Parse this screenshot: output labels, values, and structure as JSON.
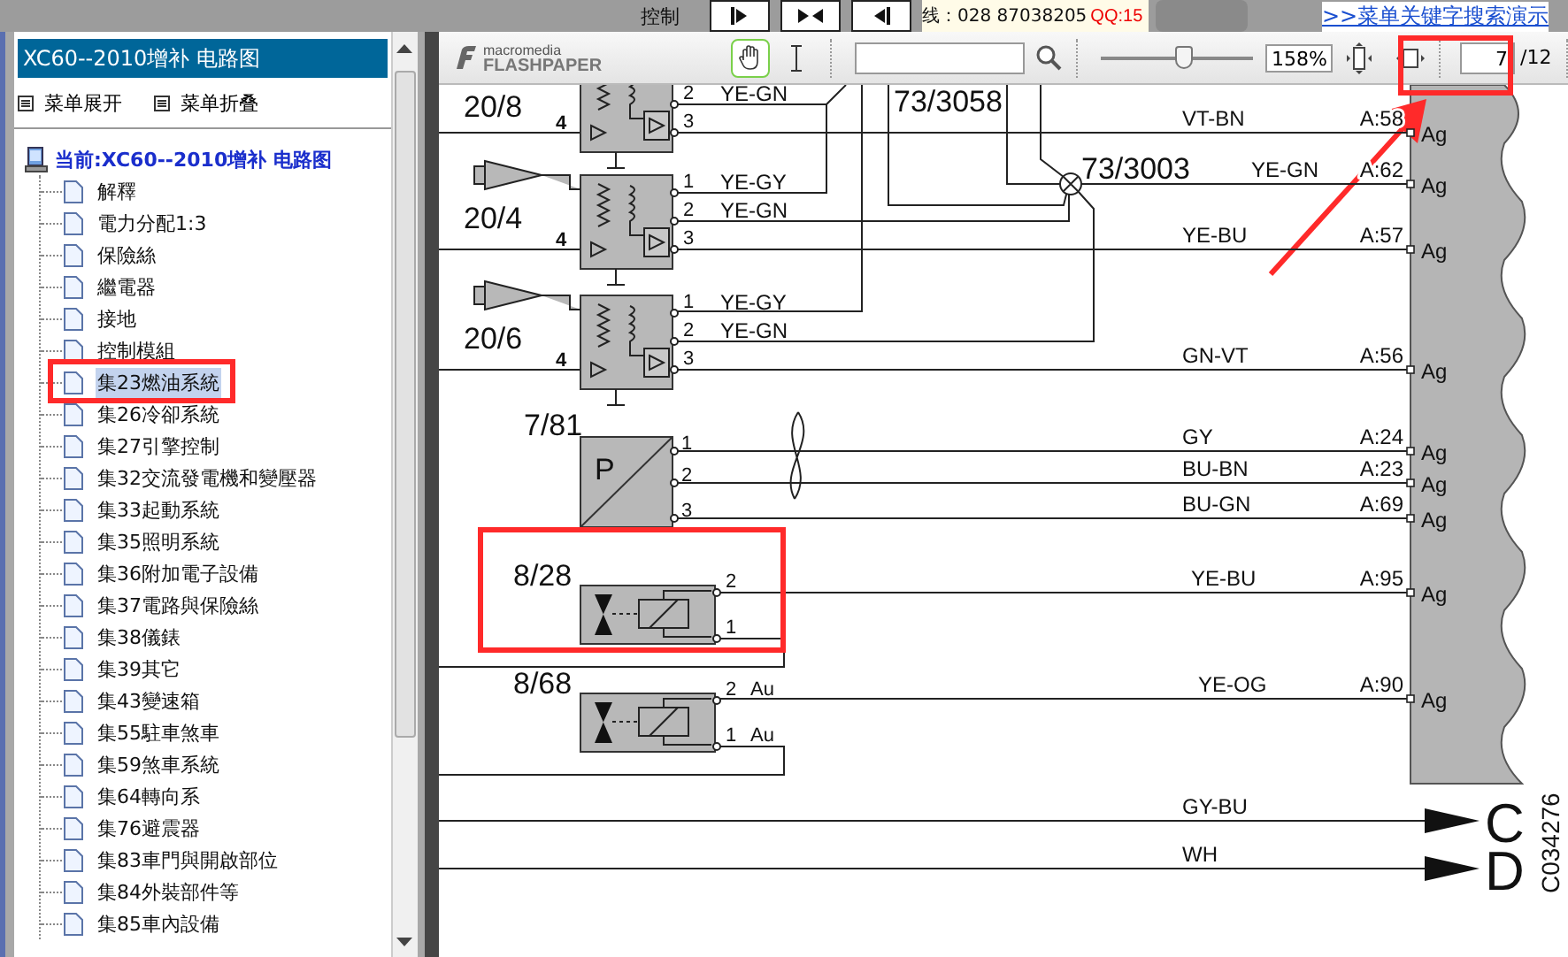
{
  "top_banner": {
    "label": "控制",
    "phone": "线：028 87038205",
    "qq": "QQ:15",
    "link": ">>菜单关键字搜索演示"
  },
  "sidebar": {
    "title": "XC60--2010增补 电路图",
    "actions": [
      "菜单展开",
      "菜单折叠"
    ],
    "tree": {
      "label": "当前:XC60--2010增补 电路图",
      "children": [
        {
          "label": "解釋",
          "selected": false
        },
        {
          "label": "電力分配1:3",
          "selected": false
        },
        {
          "label": "保險絲",
          "selected": false
        },
        {
          "label": "繼電器",
          "selected": false
        },
        {
          "label": "接地",
          "selected": false
        },
        {
          "label": "控制模組",
          "selected": false
        },
        {
          "label": "集23燃油系統",
          "selected": true
        },
        {
          "label": "集26冷卻系統",
          "selected": false
        },
        {
          "label": "集27引擎控制",
          "selected": false
        },
        {
          "label": "集32交流發電機和變壓器",
          "selected": false
        },
        {
          "label": "集33起動系統",
          "selected": false
        },
        {
          "label": "集35照明系統",
          "selected": false
        },
        {
          "label": "集36附加電子設備",
          "selected": false
        },
        {
          "label": "集37電路與保險絲",
          "selected": false
        },
        {
          "label": "集38儀錶",
          "selected": false
        },
        {
          "label": "集39其它",
          "selected": false
        },
        {
          "label": "集43變速箱",
          "selected": false
        },
        {
          "label": "集55駐車煞車",
          "selected": false
        },
        {
          "label": "集59煞車系統",
          "selected": false
        },
        {
          "label": "集64轉向系",
          "selected": false
        },
        {
          "label": "集76避震器",
          "selected": false
        },
        {
          "label": "集83車門與開啟部位",
          "selected": false
        },
        {
          "label": "集84外裝部件等",
          "selected": false
        },
        {
          "label": "集85車內設備",
          "selected": false
        }
      ]
    }
  },
  "viewer": {
    "logo": {
      "brand": "macromedia",
      "product": "FLASHPAPER"
    },
    "tools": [
      {
        "kind": "hand",
        "selected": true
      },
      {
        "kind": "text",
        "selected": false
      }
    ],
    "zoom": {
      "level": 0.55,
      "reading": "158%"
    },
    "page": {
      "value": "7",
      "total": "/12"
    }
  },
  "diagram": {
    "relays": [
      {
        "ref": "20/8",
        "ground_pin": "4",
        "injector": false,
        "pins": [
          {
            "num": "2",
            "wire": "YE-GN"
          },
          {
            "num": "3"
          }
        ]
      },
      {
        "ref": "20/4",
        "ground_pin": "4",
        "injector": true,
        "pins": [
          {
            "num": "1",
            "wire": "YE-GY"
          },
          {
            "num": "2",
            "wire": "YE-GN"
          },
          {
            "num": "3"
          }
        ]
      },
      {
        "ref": "20/6",
        "ground_pin": "4",
        "injector": true,
        "pins": [
          {
            "num": "1",
            "wire": "YE-GY"
          },
          {
            "num": "2",
            "wire": "YE-GN"
          },
          {
            "num": "3"
          }
        ]
      }
    ],
    "junction_refs": [
      "73/3058",
      "73/3003"
    ],
    "sensor": {
      "ref": "7/81",
      "symbol": "P",
      "pins": [
        "1",
        "2",
        "3"
      ]
    },
    "valves": [
      {
        "ref": "8/28",
        "pins": [
          {
            "num": "2"
          },
          {
            "num": "1"
          }
        ]
      },
      {
        "ref": "8/68",
        "pins": [
          {
            "num": "2",
            "note": "Au"
          },
          {
            "num": "1",
            "note": "Au"
          }
        ]
      }
    ],
    "connector": {
      "wires": [
        {
          "code": "VT-BN",
          "pin": "A:58",
          "terminal": "Ag"
        },
        {
          "code": "YE-GN",
          "pin": "A:62",
          "terminal": "Ag"
        },
        {
          "code": "YE-BU",
          "pin": "A:57",
          "terminal": "Ag"
        },
        {
          "code": "GN-VT",
          "pin": "A:56",
          "terminal": "Ag"
        },
        {
          "code": "GY",
          "pin": "A:24",
          "terminal": "Ag"
        },
        {
          "code": "BU-BN",
          "pin": "A:23",
          "terminal": "Ag"
        },
        {
          "code": "BU-GN",
          "pin": "A:69",
          "terminal": "Ag"
        },
        {
          "code": "YE-BU",
          "pin": "A:95",
          "terminal": "Ag"
        },
        {
          "code": "YE-OG",
          "pin": "A:90",
          "terminal": "Ag"
        }
      ]
    },
    "outputs": [
      {
        "code": "GY-BU",
        "letter": "C"
      },
      {
        "code": "WH",
        "letter": "D"
      }
    ],
    "drawing_number": "C034276"
  },
  "annotations": [
    {
      "kind": "box"
    },
    {
      "kind": "box"
    },
    {
      "kind": "box"
    },
    {
      "kind": "arrow"
    }
  ]
}
